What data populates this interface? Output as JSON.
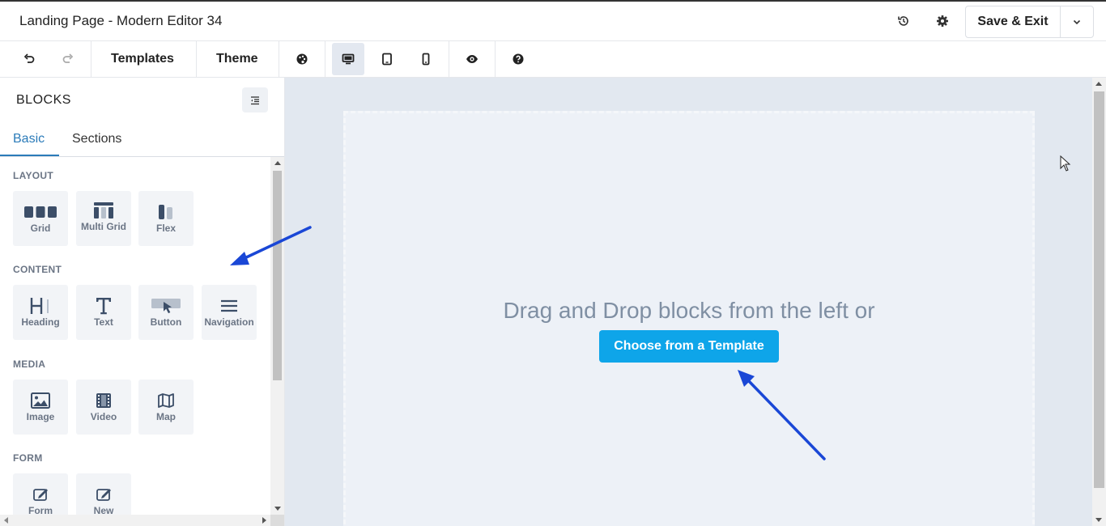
{
  "app": {
    "title": "Landing Page - Modern Editor 34",
    "save_label": "Save & Exit"
  },
  "header_icons": [
    "history-icon",
    "gear-icon",
    "chevron-down-icon"
  ],
  "toolbar": {
    "templates_label": "Templates",
    "theme_label": "Theme",
    "active_device": "desktop"
  },
  "panel": {
    "title": "BLOCKS",
    "tabs": [
      {
        "label": "Basic",
        "active": true
      },
      {
        "label": "Sections",
        "active": false
      }
    ],
    "sections": {
      "layout": {
        "label": "LAYOUT",
        "blocks": [
          "Grid",
          "Multi Grid",
          "Flex"
        ]
      },
      "content": {
        "label": "CONTENT",
        "blocks": [
          "Heading",
          "Text",
          "Button",
          "Navigation"
        ]
      },
      "media": {
        "label": "MEDIA",
        "blocks": [
          "Image",
          "Video",
          "Map"
        ]
      },
      "form": {
        "label": "FORM",
        "blocks": [
          "Form",
          "New"
        ]
      }
    }
  },
  "canvas": {
    "message": "Drag and Drop blocks from the left or",
    "cta_label": "Choose from a Template"
  },
  "colors": {
    "accent": "#0ea5e9",
    "tab_active": "#2b7bb9",
    "canvas_bg": "#e2e8f0",
    "annotation_arrow": "#1a47d6"
  }
}
